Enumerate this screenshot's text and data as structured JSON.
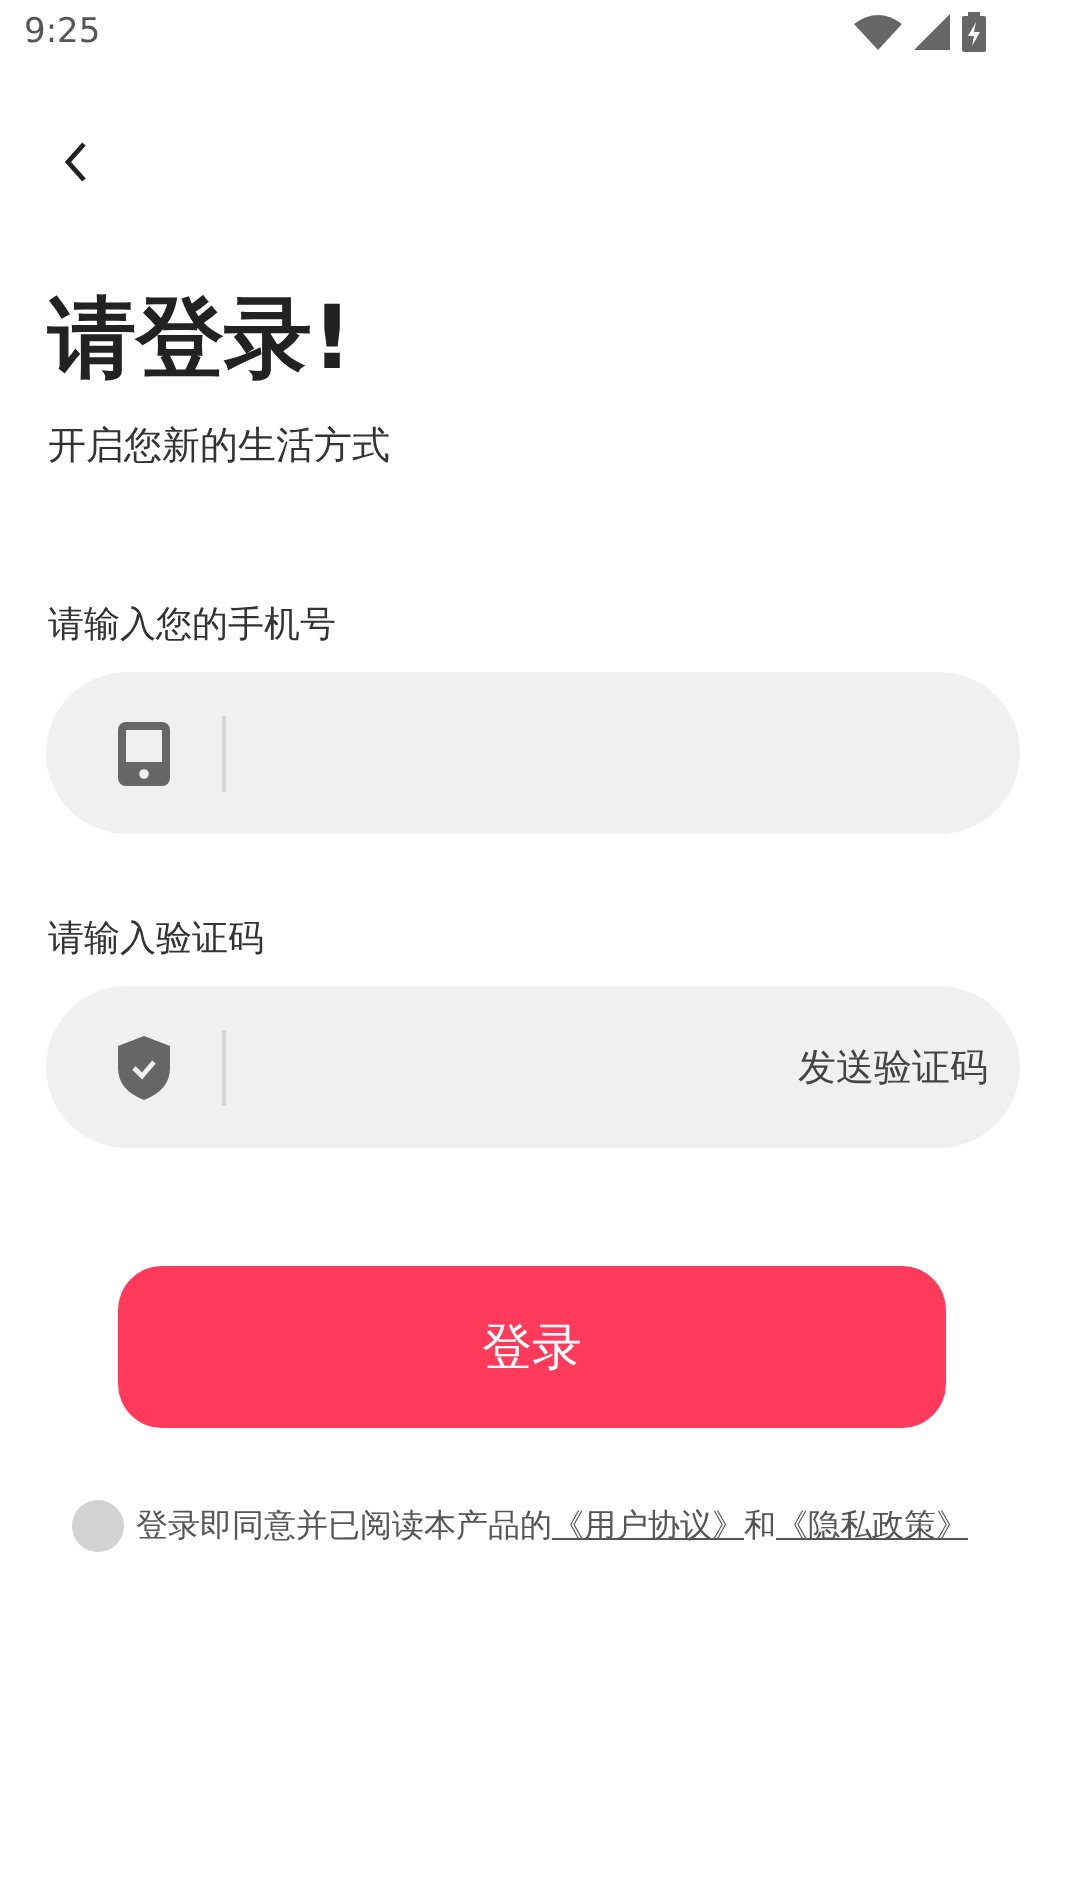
{
  "status_bar": {
    "time": "9:25"
  },
  "title": "请登录!",
  "subtitle": "开启您新的生活方式",
  "fields": [
    {
      "kind": "phone",
      "label": "请输入您的手机号"
    },
    {
      "kind": "code",
      "label": "请输入验证码",
      "action": "发送验证码"
    }
  ],
  "login_button": "登录",
  "agreement": {
    "checked": false,
    "text": "登录即同意并已阅读本产品的",
    "link_1": "《用户协议》",
    "joiner": "和",
    "link_2": "《隐私政策》"
  }
}
